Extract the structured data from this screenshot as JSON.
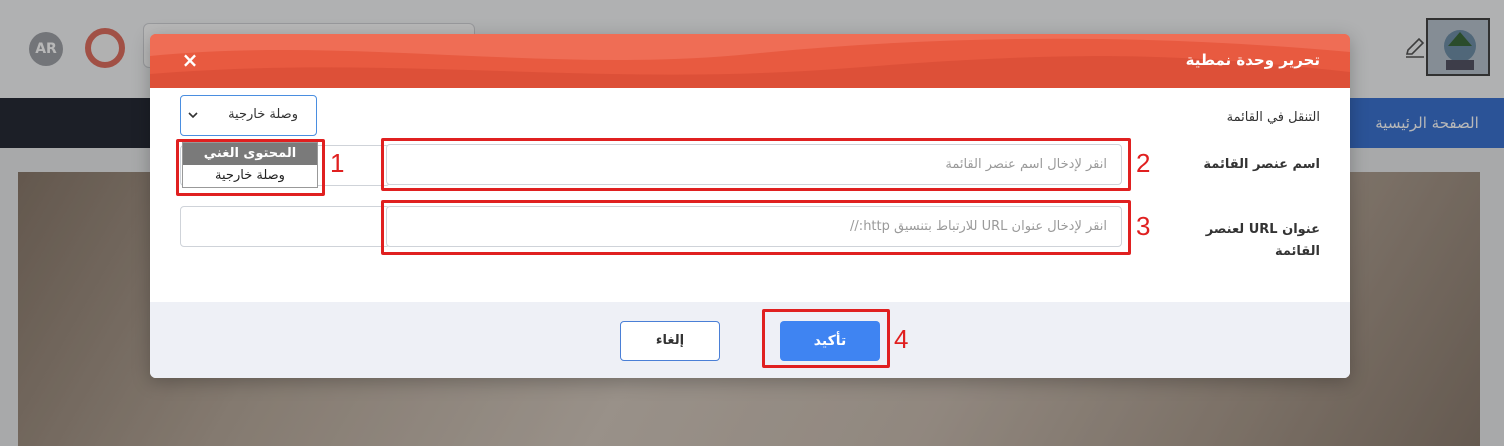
{
  "background": {
    "lang_badge": "AR",
    "nav_home": "الصفحة الرئيسية"
  },
  "modal": {
    "title": "تحرير وحدة نمطية",
    "close_icon": "×",
    "nav_label": "التنقل في القائمة",
    "nav_select_value": "وصلة خارجية",
    "nav_options": [
      "المحتوى الغني",
      "وصلة خارجية"
    ],
    "item_name_label": "اسم عنصر القائمة",
    "item_name_placeholder": "انقر لإدخال اسم عنصر القائمة",
    "url_label": "عنوان URL لعنصر القائمة",
    "url_placeholder": "انقر لإدخال عنوان URL للارتباط بتنسيق http://",
    "cancel_label": "إلغاء",
    "confirm_label": "تأكيد"
  },
  "annotations": [
    "1",
    "2",
    "3",
    "4"
  ],
  "colors": {
    "header": "#e85a40",
    "confirm": "#3f84f2",
    "annotation": "#e02020",
    "navbar": "#272c36",
    "nav_active": "#3c73d2"
  },
  "icons": {
    "close": "close-icon",
    "select": "chevron-down-icon",
    "edit": "pencil-icon"
  }
}
